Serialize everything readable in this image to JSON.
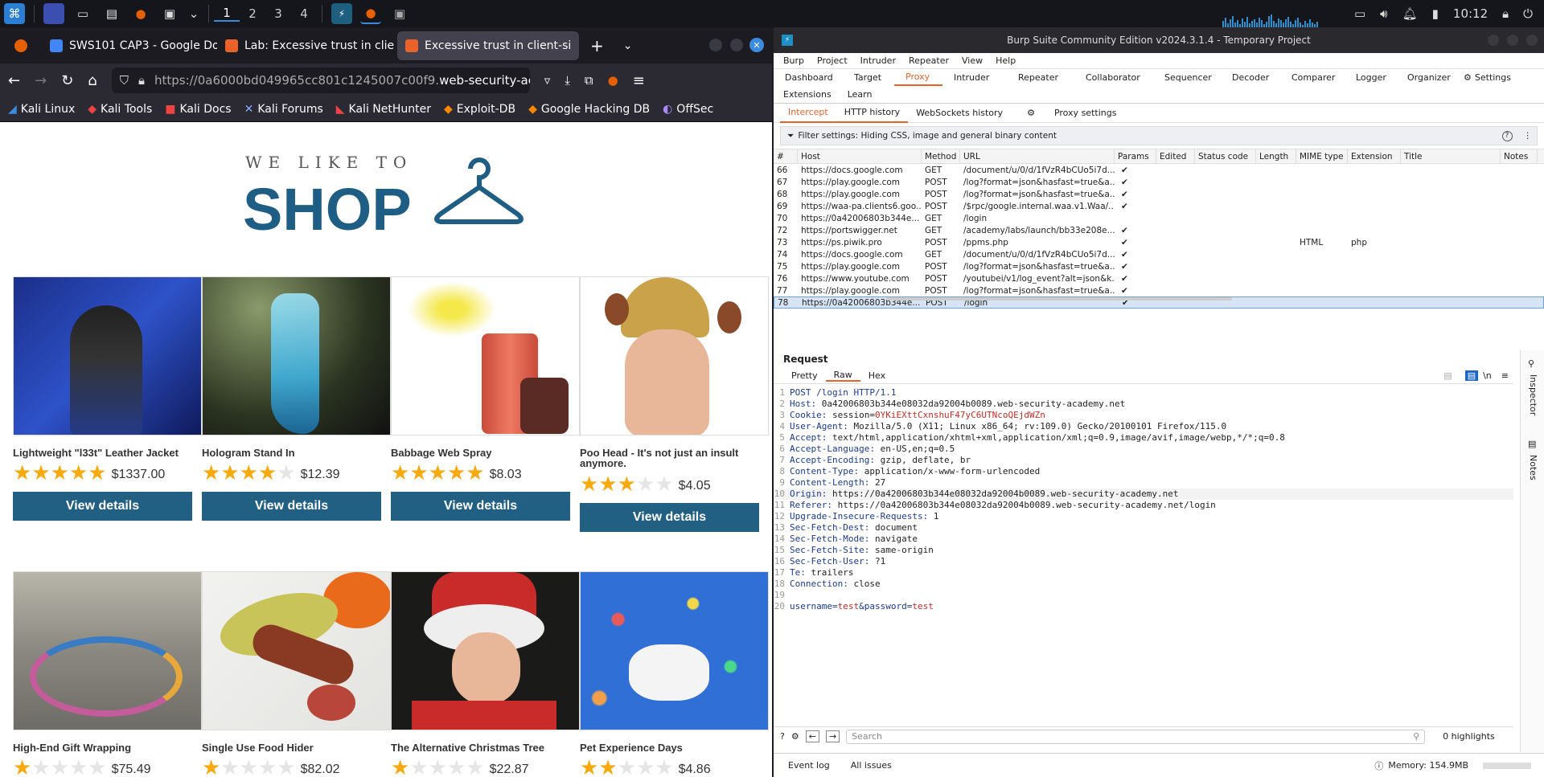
{
  "taskbar": {
    "workspaces": [
      "1",
      "2",
      "3",
      "4"
    ],
    "time": "10:12"
  },
  "firefox": {
    "tabs": [
      {
        "label": ""
      },
      {
        "label": "SWS101 CAP3 - Google Do"
      },
      {
        "label": "Lab: Excessive trust in clie"
      },
      {
        "label": "Excessive trust in client-si"
      }
    ],
    "url_prefix": "https://0a6000bd049965cc801c1245007c00f9.",
    "url_domain": "web-security-ac",
    "bookmarks": [
      "Kali Linux",
      "Kali Tools",
      "Kali Docs",
      "Kali Forums",
      "Kali NetHunter",
      "Exploit-DB",
      "Google Hacking DB",
      "OffSec"
    ]
  },
  "shop": {
    "logo_top": "WE LIKE TO",
    "logo_main": "SHOP",
    "view_label": "View details",
    "products": [
      {
        "name": "Lightweight \"l33t\" Leather Jacket",
        "rating": 5,
        "price": "$1337.00"
      },
      {
        "name": "Hologram Stand In",
        "rating": 4,
        "price": "$12.39"
      },
      {
        "name": "Babbage Web Spray",
        "rating": 5,
        "price": "$8.03"
      },
      {
        "name": "Poo Head - It's not just an insult anymore.",
        "rating": 3,
        "price": "$4.05"
      },
      {
        "name": "High-End Gift Wrapping",
        "rating": 1,
        "price": "$75.49"
      },
      {
        "name": "Single Use Food Hider",
        "rating": 1,
        "price": "$82.02"
      },
      {
        "name": "The Alternative Christmas Tree",
        "rating": 1,
        "price": "$22.87"
      },
      {
        "name": "Pet Experience Days",
        "rating": 2,
        "price": "$4.86"
      }
    ]
  },
  "burp": {
    "title": "Burp Suite Community Edition v2024.3.1.4 - Temporary Project",
    "menu": [
      "Burp",
      "Project",
      "Intruder",
      "Repeater",
      "View",
      "Help"
    ],
    "tabs": [
      "Dashboard",
      "Target",
      "Proxy",
      "Intruder",
      "Repeater",
      "Collaborator",
      "Sequencer",
      "Decoder",
      "Comparer",
      "Logger",
      "Organizer",
      "Settings",
      "Extensions",
      "Learn"
    ],
    "subtabs": [
      "Intercept",
      "HTTP history",
      "WebSockets history",
      "Proxy settings"
    ],
    "filter": "Filter settings: Hiding CSS, image and general binary content",
    "columns": [
      "#",
      "Host",
      "Method",
      "URL",
      "Params",
      "Edited",
      "Status code",
      "Length",
      "MIME type",
      "Extension",
      "Title",
      "Notes"
    ],
    "rows": [
      {
        "n": "66",
        "host": "https://docs.google.com",
        "method": "GET",
        "url": "/document/u/0/d/1fVzR4bCUo5i7d...",
        "params": "✔",
        "mime": "",
        "ext": ""
      },
      {
        "n": "67",
        "host": "https://play.google.com",
        "method": "POST",
        "url": "/log?format=json&hasfast=true&a...",
        "params": "✔",
        "mime": "",
        "ext": ""
      },
      {
        "n": "68",
        "host": "https://play.google.com",
        "method": "POST",
        "url": "/log?format=json&hasfast=true&a...",
        "params": "✔",
        "mime": "",
        "ext": ""
      },
      {
        "n": "69",
        "host": "https://waa-pa.clients6.goo...",
        "method": "POST",
        "url": "/$rpc/google.internal.waa.v1.Waa/...",
        "params": "✔",
        "mime": "",
        "ext": ""
      },
      {
        "n": "70",
        "host": "https://0a42006803b344e...",
        "method": "GET",
        "url": "/login",
        "params": "",
        "mime": "",
        "ext": ""
      },
      {
        "n": "72",
        "host": "https://portswigger.net",
        "method": "GET",
        "url": "/academy/labs/launch/bb33e208e...",
        "params": "✔",
        "mime": "",
        "ext": ""
      },
      {
        "n": "73",
        "host": "https://ps.piwik.pro",
        "method": "POST",
        "url": "/ppms.php",
        "params": "✔",
        "mime": "HTML",
        "ext": "php"
      },
      {
        "n": "74",
        "host": "https://docs.google.com",
        "method": "GET",
        "url": "/document/u/0/d/1fVzR4bCUo5i7d...",
        "params": "✔",
        "mime": "",
        "ext": ""
      },
      {
        "n": "75",
        "host": "https://play.google.com",
        "method": "POST",
        "url": "/log?format=json&hasfast=true&a...",
        "params": "✔",
        "mime": "",
        "ext": ""
      },
      {
        "n": "76",
        "host": "https://www.youtube.com",
        "method": "POST",
        "url": "/youtubei/v1/log_event?alt=json&k...",
        "params": "✔",
        "mime": "",
        "ext": ""
      },
      {
        "n": "77",
        "host": "https://play.google.com",
        "method": "POST",
        "url": "/log?format=json&hasfast=true&a...",
        "params": "✔",
        "mime": "",
        "ext": ""
      },
      {
        "n": "78",
        "host": "https://0a42006803b344e...",
        "method": "POST",
        "url": "/login",
        "params": "✔",
        "mime": "",
        "ext": ""
      }
    ],
    "request_title": "Request",
    "request_tabs": [
      "Pretty",
      "Raw",
      "Hex"
    ],
    "request_lines": [
      {
        "k": "POST /login HTTP/1.1",
        "v": ""
      },
      {
        "k": "Host:",
        "v": " 0a42006803b344e08032da92004b0089.web-security-academy.net"
      },
      {
        "k": "Cookie:",
        "v": " session=",
        "r": "0YKiEXttCxnshuF47yC6UTNcoQEjdWZn"
      },
      {
        "k": "User-Agent:",
        "v": " Mozilla/5.0 (X11; Linux x86_64; rv:109.0) Gecko/20100101 Firefox/115.0"
      },
      {
        "k": "Accept:",
        "v": " text/html,application/xhtml+xml,application/xml;q=0.9,image/avif,image/webp,*/*;q=0.8"
      },
      {
        "k": "Accept-Language:",
        "v": " en-US,en;q=0.5"
      },
      {
        "k": "Accept-Encoding:",
        "v": " gzip, deflate, br"
      },
      {
        "k": "Content-Type:",
        "v": " application/x-www-form-urlencoded"
      },
      {
        "k": "Content-Length:",
        "v": " 27"
      },
      {
        "k": "Origin:",
        "v": " https://0a42006803b344e08032da92004b0089.web-security-academy.net"
      },
      {
        "k": "Referer:",
        "v": " https://0a42006803b344e08032da92004b0089.web-security-academy.net/login"
      },
      {
        "k": "Upgrade-Insecure-Requests:",
        "v": " 1"
      },
      {
        "k": "Sec-Fetch-Dest:",
        "v": " document"
      },
      {
        "k": "Sec-Fetch-Mode:",
        "v": " navigate"
      },
      {
        "k": "Sec-Fetch-Site:",
        "v": " same-origin"
      },
      {
        "k": "Sec-Fetch-User:",
        "v": " ?1"
      },
      {
        "k": "Te:",
        "v": " trailers"
      },
      {
        "k": "Connection:",
        "v": " close"
      },
      {
        "k": "",
        "v": ""
      },
      {
        "k": "",
        "v": "",
        "body": true
      }
    ],
    "body_parts": [
      "username",
      "=",
      "test",
      "&",
      "password",
      "=",
      "test"
    ],
    "side_inspector": "Inspector",
    "side_notes": "Notes",
    "search_placeholder": "Search",
    "highlights": "0 highlights",
    "status_left": [
      "Event log",
      "All issues"
    ],
    "memory": "Memory: 154.9MB"
  }
}
